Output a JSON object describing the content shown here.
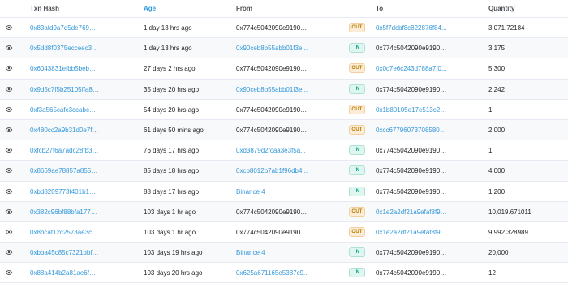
{
  "columns": {
    "hash": "Txn Hash",
    "age": "Age",
    "from": "From",
    "to": "To",
    "quantity": "Quantity"
  },
  "colors": {
    "link": "#3498db",
    "out_badge": "#fcecd6",
    "in_badge": "#dff5ef"
  },
  "rows": [
    {
      "hash": "0x83afd9a7d5de76998...",
      "age": "1 day 13 hrs ago",
      "from": "0x774c5042090e91907...",
      "dir": "OUT",
      "to": "0x5f7dcbf8c822876f84...",
      "qty": "3,071.72184"
    },
    {
      "hash": "0x5dd8f0375ecceec3cf...",
      "age": "1 day 13 hrs ago",
      "from": "0x90ceb8b55abb01f3e...",
      "dir": "IN",
      "to": "0x774c5042090e91907...",
      "qty": "3,175"
    },
    {
      "hash": "0x6043831efbb5bebd5...",
      "age": "27 days 2 hrs ago",
      "from": "0x774c5042090e91907...",
      "dir": "OUT",
      "to": "0x0c7e6c243d788a7f0...",
      "qty": "5,300"
    },
    {
      "hash": "0x9d5c7f5b25105ffa85...",
      "age": "35 days 20 hrs ago",
      "from": "0x90ceb8b55abb01f3e...",
      "dir": "IN",
      "to": "0x774c5042090e91907...",
      "qty": "2,242"
    },
    {
      "hash": "0xf3a565cafc3ccabc44...",
      "age": "54 days 20 hrs ago",
      "from": "0x774c5042090e91907...",
      "dir": "OUT",
      "to": "0x1b80105e17e513c23...",
      "qty": "1"
    },
    {
      "hash": "0x480cc2a9b31d0e7ff...",
      "age": "61 days 50 mins ago",
      "from": "0x774c5042090e91907...",
      "dir": "OUT",
      "to": "0xcc67796073708580d...",
      "qty": "2,000"
    },
    {
      "hash": "0xfcb27f6a7adc28fb3f...",
      "age": "76 days 17 hrs ago",
      "from": "0xd3879d2fcaa3e3f5a...",
      "dir": "IN",
      "to": "0x774c5042090e91907...",
      "qty": "1"
    },
    {
      "hash": "0x8669ae78857a855a1...",
      "age": "85 days 18 hrs ago",
      "from": "0xcb8012b7ab1f96db4...",
      "dir": "IN",
      "to": "0x774c5042090e91907...",
      "qty": "4,000"
    },
    {
      "hash": "0xbd8209773f401b144...",
      "age": "88 days 17 hrs ago",
      "from": "Binance 4",
      "dir": "IN",
      "to": "0x774c5042090e91907...",
      "qty": "1,200"
    },
    {
      "hash": "0x382c96bf88bfa1771...",
      "age": "103 days 1 hr ago",
      "from": "0x774c5042090e91907...",
      "dir": "OUT",
      "to": "0x1e2a2df21a9efaf8f9f...",
      "qty": "10,019.671011"
    },
    {
      "hash": "0x8bcaf12c2573ae3cb...",
      "age": "103 days 1 hr ago",
      "from": "0x774c5042090e91907...",
      "dir": "OUT",
      "to": "0x1e2a2df21a9efaf8f9f...",
      "qty": "9,992.328989"
    },
    {
      "hash": "0xbba45c85c7321bbf5...",
      "age": "103 days 19 hrs ago",
      "from": "Binance 4",
      "dir": "IN",
      "to": "0x774c5042090e91907...",
      "qty": "20,000"
    },
    {
      "hash": "0x88a414b2a81ae6fa9...",
      "age": "103 days 20 hrs ago",
      "from": "0x625a671165e5387c9...",
      "dir": "IN",
      "to": "0x774c5042090e91907...",
      "qty": "12"
    }
  ]
}
